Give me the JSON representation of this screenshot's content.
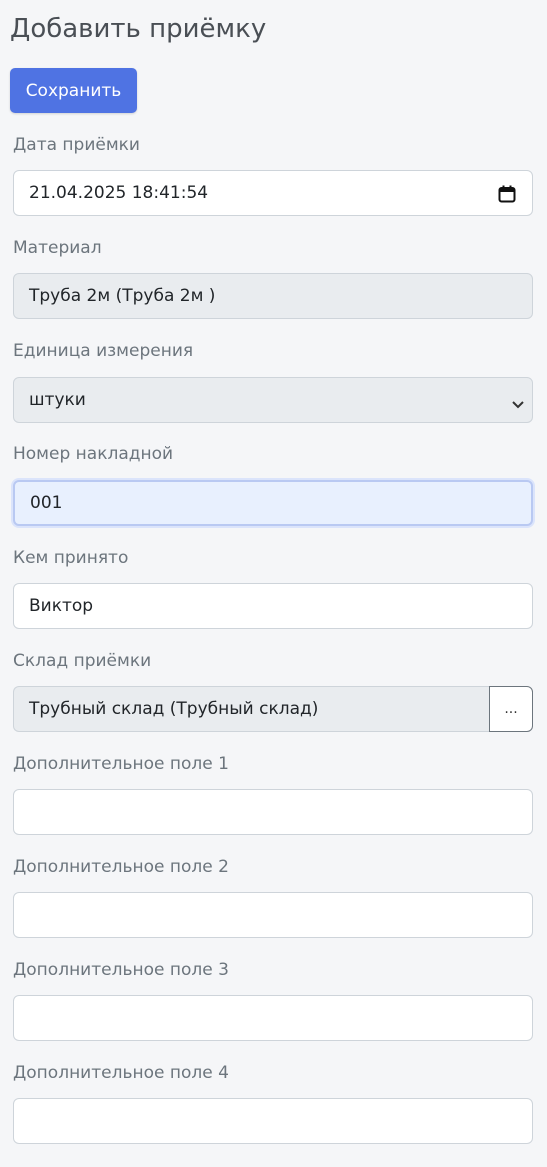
{
  "header": {
    "title": "Добавить приёмку"
  },
  "toolbar": {
    "save_label": "Сохранить"
  },
  "form": {
    "date": {
      "label": "Дата приёмки",
      "value": "21.04.2025 18:41:54"
    },
    "material": {
      "label": "Материал",
      "value": "Труба 2м (Труба 2м )"
    },
    "unit": {
      "label": "Единица измерения",
      "value": "штуки"
    },
    "invoice": {
      "label": "Номер накладной",
      "value": "001"
    },
    "accepted_by": {
      "label": "Кем принято",
      "value": "Виктор"
    },
    "warehouse": {
      "label": "Склад приёмки",
      "value": "Трубный склад (Трубный склад)",
      "button_label": "..."
    },
    "extra1": {
      "label": "Дополнительное поле 1",
      "value": ""
    },
    "extra2": {
      "label": "Дополнительное поле 2",
      "value": ""
    },
    "extra3": {
      "label": "Дополнительное поле 3",
      "value": ""
    },
    "extra4": {
      "label": "Дополнительное поле 4",
      "value": ""
    }
  },
  "icons": {
    "date": "calendar-icon",
    "unit": "chevron-down-icon"
  },
  "colors": {
    "accent": "#4f73e3",
    "focus_bg": "#e8f0fe",
    "disabled_bg": "#e9ecef"
  }
}
